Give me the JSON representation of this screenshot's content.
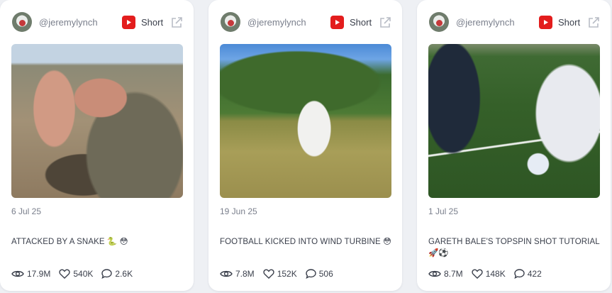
{
  "cards": [
    {
      "handle": "@jeremylynch",
      "platform": "Short",
      "platform_icon": "youtube-icon",
      "date": "6 Jul 25",
      "caption": "ATTACKED BY A SNAKE 🐍 😳",
      "views": "17.9M",
      "likes": "540K",
      "comments": "2.6K"
    },
    {
      "handle": "@jeremylynch",
      "platform": "Short",
      "platform_icon": "youtube-icon",
      "date": "19 Jun 25",
      "caption": "FOOTBALL KICKED INTO WIND TURBINE 😳",
      "views": "7.8M",
      "likes": "152K",
      "comments": "506"
    },
    {
      "handle": "@jeremylynch",
      "platform": "Short",
      "platform_icon": "youtube-icon",
      "date": "1 Jul 25",
      "caption": "GARETH BALE'S TOPSPIN SHOT TUTORIAL 🚀⚽",
      "views": "8.7M",
      "likes": "148K",
      "comments": "422"
    }
  ],
  "colors": {
    "youtube_red": "#e31d1d",
    "muted_text": "#7a7f8c",
    "body_text": "#3a3f4b",
    "card_bg": "#ffffff",
    "page_bg": "#eef0f4"
  }
}
